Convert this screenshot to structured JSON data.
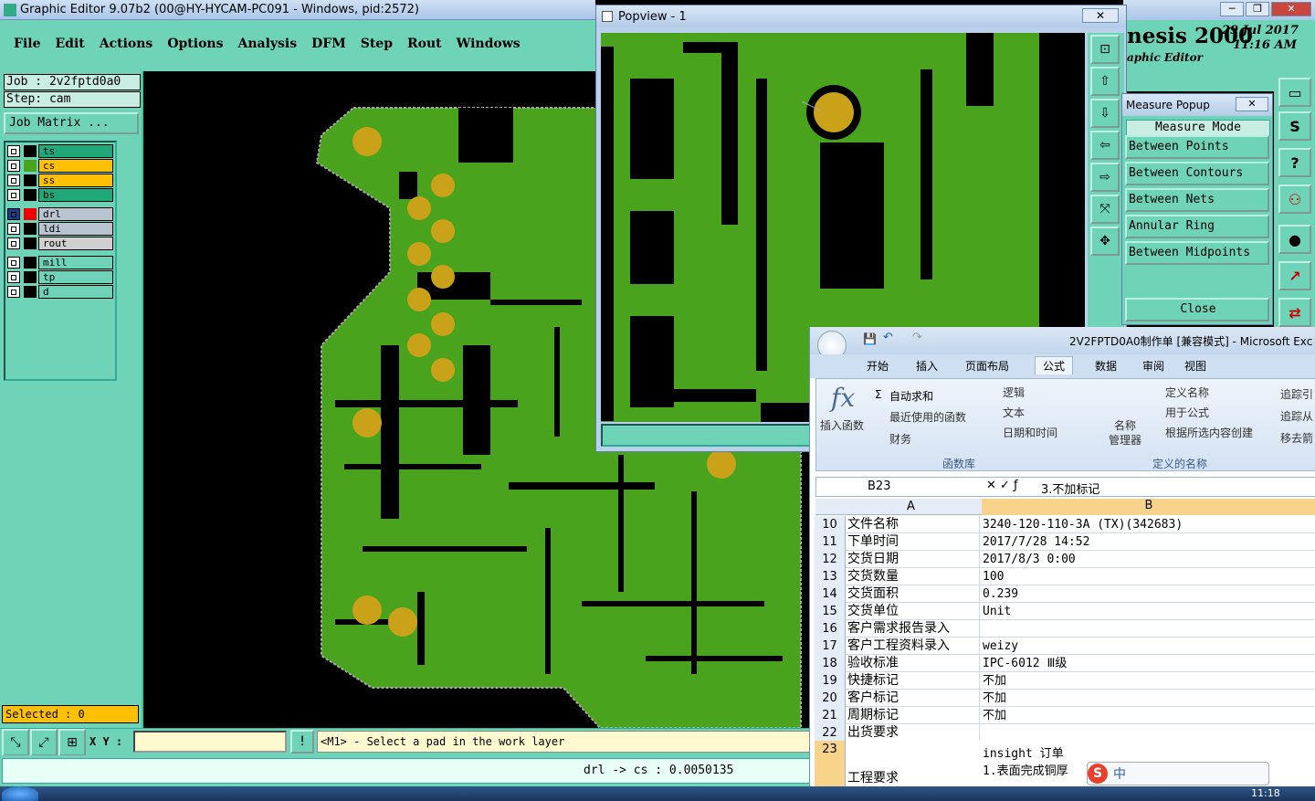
{
  "main_window": {
    "title": "Graphic Editor 9.07b2 (00@HY-HYCAM-PC091 - Windows, pid:2572)"
  },
  "menu": [
    "File",
    "Edit",
    "Actions",
    "Options",
    "Analysis",
    "DFM",
    "Step",
    "Rout",
    "Windows"
  ],
  "job": {
    "job_label": "Job : 2v2fptd0a0",
    "step_label": "Step: cam",
    "matrix_button": "Job Matrix ..."
  },
  "layers": [
    {
      "name": "ts",
      "color": "#20a878"
    },
    {
      "name": "cs",
      "color": "#ffc000"
    },
    {
      "name": "ss",
      "color": "#ffc000"
    },
    {
      "name": "bs",
      "color": "#20a878"
    },
    {
      "name": "drl",
      "color": "#b8c4d0"
    },
    {
      "name": "ldi",
      "color": "#b8c4d0"
    },
    {
      "name": "rout",
      "color": "#d0d0d0"
    },
    {
      "name": "mill",
      "color": "#6fd3b8"
    },
    {
      "name": "tp",
      "color": "#6fd3b8"
    },
    {
      "name": "d",
      "color": "#6fd3b8"
    }
  ],
  "status": {
    "selected": "Selected : 0",
    "xy_label": "X Y :",
    "xy_value": "",
    "message": "<M1> - Select a pad in the work layer",
    "measure_result": "drl -> cs : 0.0050135"
  },
  "brand": {
    "name": "nesis 2000",
    "sub": "aphic Editor",
    "date": "29 Jul 2017",
    "time": "11:16 AM"
  },
  "popview": {
    "title": "Popview - 1",
    "close": "✕"
  },
  "measure_popup": {
    "title": "Measure Popup",
    "header": "Measure Mode",
    "buttons": [
      "Between Points",
      "Between Contours",
      "Between Nets",
      "Annular Ring",
      "Between Midpoints"
    ],
    "close_label": "Close"
  },
  "excel": {
    "title": "2V2FPTD0A0制作单 [兼容模式] - Microsoft Exc",
    "tabs": [
      "开始",
      "插入",
      "页面布局",
      "公式",
      "数据",
      "审阅",
      "视图"
    ],
    "active_tab": "公式",
    "ribbon": {
      "insert_func": "插入函数",
      "autosum": "自动求和",
      "recent": "最近使用的函数",
      "finance": "财务",
      "logic": "逻辑",
      "text": "文本",
      "datetime": "日期和时间",
      "name_mgr1": "名称",
      "name_mgr2": "管理器",
      "define_name": "定义名称",
      "use_in_formula": "用于公式",
      "create_from_sel": "根据所选内容创建",
      "trace1": "追踪引",
      "trace2": "追踪从",
      "remove": "移去箭",
      "group_lib": "函数库",
      "group_names": "定义的名称"
    },
    "name_box": "B23",
    "formula": "3.不加标记",
    "col_a": "A",
    "col_b": "B",
    "rows": [
      {
        "n": "10",
        "a": "文件名称",
        "b": "3240-120-110-3A (TX)(342683)"
      },
      {
        "n": "11",
        "a": "下单时间",
        "b": "2017/7/28 14:52"
      },
      {
        "n": "12",
        "a": "交货日期",
        "b": "2017/8/3 0:00"
      },
      {
        "n": "13",
        "a": "交货数量",
        "b": "100"
      },
      {
        "n": "14",
        "a": "交货面积",
        "b": "0.239"
      },
      {
        "n": "15",
        "a": "交货单位",
        "b": "Unit"
      },
      {
        "n": "16",
        "a": "客户需求报告录入",
        "b": ""
      },
      {
        "n": "17",
        "a": "客户工程资料录入",
        "b": "weizy"
      },
      {
        "n": "18",
        "a": "验收标准",
        "b": "IPC-6012 Ⅲ级"
      },
      {
        "n": "19",
        "a": "快捷标记",
        "b": "不加"
      },
      {
        "n": "20",
        "a": "客户标记",
        "b": "不加"
      },
      {
        "n": "21",
        "a": "周期标记",
        "b": "不加"
      },
      {
        "n": "22",
        "a": "出货要求",
        "b": ""
      }
    ],
    "row23_label": "工程要求",
    "row23_b1": "insight 订单",
    "row23_b2": "1.表面完成铜厚"
  },
  "ime": {
    "label": "中"
  },
  "clock": "11:18"
}
